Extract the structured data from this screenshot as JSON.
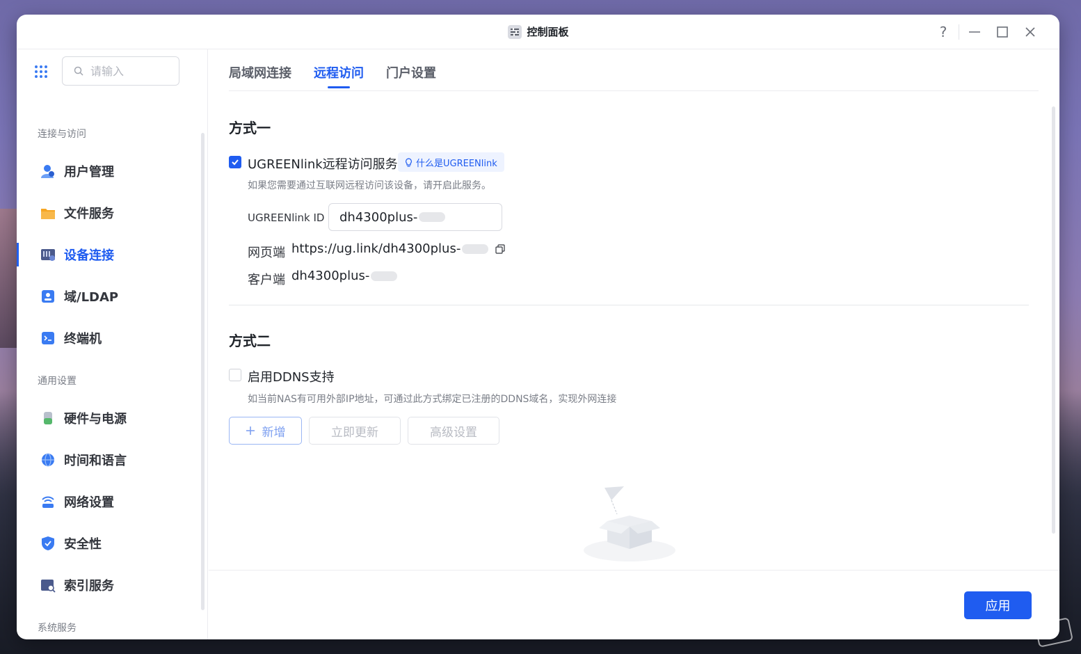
{
  "window": {
    "title": "控制面板"
  },
  "sidebar": {
    "search_placeholder": "请输入",
    "sections": [
      {
        "label": "连接与访问"
      },
      {
        "label": "通用设置"
      },
      {
        "label": "系统服务"
      }
    ],
    "items": [
      {
        "label": "用户管理",
        "icon": "user-management-icon",
        "color": "#3a7bf2"
      },
      {
        "label": "文件服务",
        "icon": "folder-icon",
        "color": "#f6a623"
      },
      {
        "label": "设备连接",
        "icon": "device-connection-icon",
        "color": "#4b5a8c",
        "active": true
      },
      {
        "label": "域/LDAP",
        "icon": "domain-ldap-icon",
        "color": "#3a7bf2"
      },
      {
        "label": "终端机",
        "icon": "terminal-icon",
        "color": "#3a7bf2"
      },
      {
        "label": "硬件与电源",
        "icon": "hardware-power-icon",
        "color": "#55b86b"
      },
      {
        "label": "时间和语言",
        "icon": "globe-icon",
        "color": "#3a7bf2"
      },
      {
        "label": "网络设置",
        "icon": "network-icon",
        "color": "#3a7bf2"
      },
      {
        "label": "安全性",
        "icon": "shield-icon",
        "color": "#3a7bf2"
      },
      {
        "label": "索引服务",
        "icon": "index-service-icon",
        "color": "#4b5a8c"
      }
    ]
  },
  "tabs": [
    {
      "label": "局域网连接"
    },
    {
      "label": "远程访问",
      "active": true
    },
    {
      "label": "门户设置"
    }
  ],
  "method1": {
    "heading": "方式一",
    "checkbox_label": "UGREENlink远程访问服务",
    "checked": true,
    "tag_label": "什么是UGREENlink",
    "description": "如果您需要通过互联网远程访问该设备，请开启此服务。",
    "id_label": "UGREENlink ID",
    "id_value": "dh4300plus-",
    "web_label": "网页端",
    "web_value": "https://ug.link/dh4300plus-",
    "client_label": "客户端",
    "client_value": "dh4300plus-"
  },
  "method2": {
    "heading": "方式二",
    "checkbox_label": "启用DDNS支持",
    "checked": false,
    "description": "如当前NAS有可用外部IP地址，可通过此方式绑定已注册的DDNS域名，实现外网连接",
    "add_button": "新增",
    "update_button": "立即更新",
    "advanced_button": "高级设置"
  },
  "footer": {
    "apply_button": "应用"
  },
  "colors": {
    "accent": "#1f5cf0"
  }
}
